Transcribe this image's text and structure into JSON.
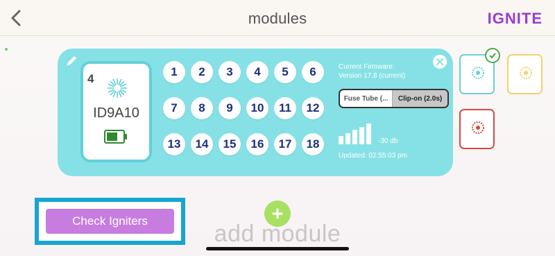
{
  "header": {
    "title": "modules",
    "brand": "IGNITE"
  },
  "module": {
    "number": "4",
    "id": "ID9A10",
    "cues": [
      "1",
      "2",
      "3",
      "4",
      "5",
      "6",
      "7",
      "8",
      "9",
      "10",
      "11",
      "12",
      "13",
      "14",
      "15",
      "16",
      "17",
      "18"
    ],
    "firmware_title": "Current Firmware:",
    "firmware_version": "Version 17.8 (current)",
    "mode_options": [
      "Fuse Tube (...",
      "Clip-on (2.0s)"
    ],
    "mode_selected": "Clip-on (2.0s)",
    "signal_text": "-30 db",
    "signal_bars": 5,
    "updated": "Updated: 02:55:03 pm",
    "battery_level": 0.66
  },
  "side_modules": [
    {
      "color": "#6dcfd6",
      "selected": true,
      "icon": "burst-icon"
    },
    {
      "color": "#f1d36a",
      "selected": false,
      "icon": "burst-icon"
    },
    {
      "color": "#d54a3e",
      "selected": false,
      "icon": "burst-icon"
    }
  ],
  "actions": {
    "check_label": "Check Igniters",
    "add_label": "add module"
  },
  "colors": {
    "accent": "#86e1e6",
    "brand": "#9b3ccf",
    "check_btn": "#c77de0",
    "add_btn": "#a8e064",
    "highlight": "#18a5d2"
  }
}
